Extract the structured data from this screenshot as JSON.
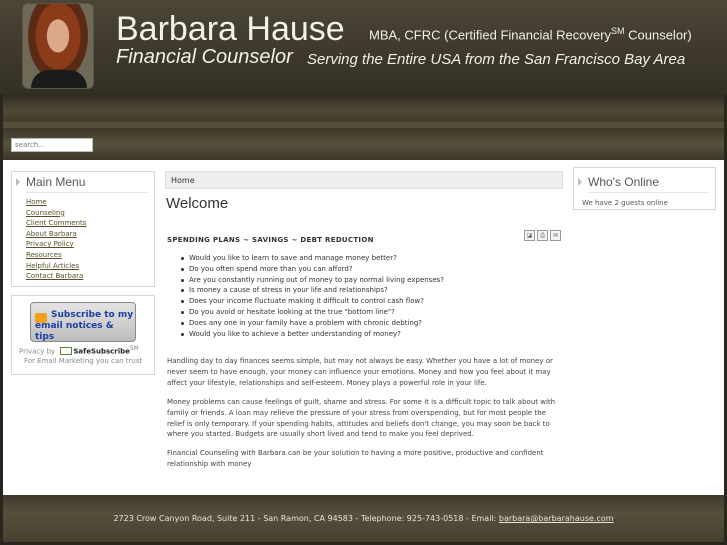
{
  "header": {
    "name": "Barbara Hause",
    "credentials_prefix": "MBA, CFRC (Certified Financial Recovery",
    "credentials_sup": "SM",
    "credentials_suffix": " Counselor)",
    "title": "Financial Counselor",
    "tagline": "Serving the Entire USA from the San Francisco Bay Area"
  },
  "search": {
    "placeholder": "search..."
  },
  "main_menu": {
    "title": "Main Menu",
    "items": [
      "Home",
      "Counseling",
      "Client Comments",
      "About Barbara",
      "Privacy Policy",
      "Resources",
      "Helpful Articles",
      "Contact Barbara"
    ]
  },
  "subscribe": {
    "button_label": "Subscribe to my email notices & tips",
    "privacy_prefix": "Privacy by",
    "brand": "SafeSubscribe",
    "brand_sup": "SM",
    "tagline": "For Email Marketing you can trust"
  },
  "whos_online": {
    "title": "Who's Online",
    "text": "We have 2 guests online"
  },
  "content": {
    "breadcrumb": "Home",
    "heading": "Welcome",
    "tools": [
      "pdf-icon",
      "print-icon",
      "email-icon"
    ],
    "subhead": "SPENDING PLANS  ~  SAVINGS  ~  DEBT REDUCTION",
    "bullets": [
      "Would you like to learn to save and manage money better?",
      "Do you often spend more than you can afford?",
      "Are you constantly running out of money to pay normal living expenses?",
      "Is money a cause of stress in your life and relationships?",
      "Does your income fluctuate making it difficult to control cash flow?",
      "Do you avoid or hesitate looking at the true \"bottom line\"?",
      "Does any one in your family have a problem with chronic debting?",
      "Would you like to achieve a better understanding of money?"
    ],
    "paragraphs": [
      "Handling day to day finances seems simple, but may not always be easy. Whether you have a lot of money or never seem to have enough, your money can influence your emotions. Money and how you feel about it may affect your lifestyle, relationships and self-esteem. Money plays a powerful role in your life.",
      "Money problems can cause feelings of guilt, shame and stress. For some it is a difficult topic to talk about with family or friends. A loan may relieve the pressure of your stress from overspending, but for most people the relief is only temporary. If your spending habits, attitudes and beliefs don't change, you may soon be back to where you started. Budgets are usually short lived and tend to make you feel deprived.",
      "Financial Counseling with Barbara can be your solution to having a more positive, productive and confident relationship with money"
    ]
  },
  "footer": {
    "address": "2723 Crow Canyon Road, Suite 211 - San Ramon, CA 94583 - Telephone: 925-743-0518 - Email: ",
    "email": "barbara@barbarahause.com"
  }
}
